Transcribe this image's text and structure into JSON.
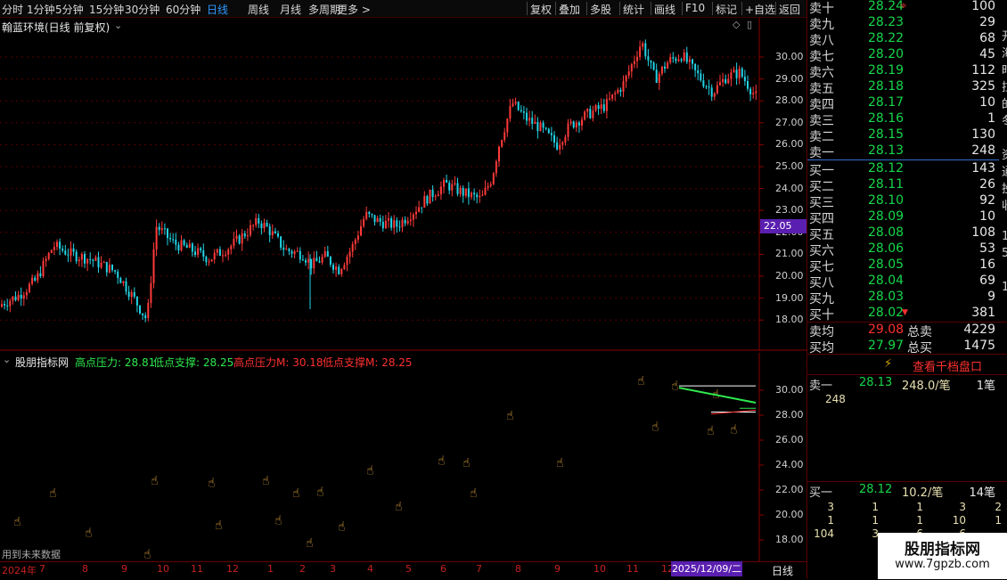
{
  "toolbar": {
    "periods": [
      "分时",
      "1分钟",
      "5分钟",
      "15分钟",
      "30分钟",
      "60分钟",
      "日线",
      "周线",
      "月线",
      "多周期",
      "更多 >"
    ],
    "active_period": "日线",
    "tools": [
      "复权",
      "叠加",
      "多股",
      "统计",
      "画线",
      "F10",
      "标记",
      "+自选",
      "返回"
    ]
  },
  "main_chart": {
    "title": "翰蓝环境(日线 前复权)",
    "current_price_badge": "22.05",
    "y_ticks": [
      "30.00",
      "29.00",
      "28.00",
      "27.00",
      "26.00",
      "25.00",
      "24.00",
      "23.00",
      "22.00",
      "21.00",
      "20.00",
      "19.00",
      "18.00"
    ]
  },
  "indicator": {
    "name": "股朋指标网",
    "items": [
      {
        "label": "高点压力: 28.81",
        "color": "#2ee84e"
      },
      {
        "label": "低点支撑: 28.25",
        "color": "#2ee84e"
      },
      {
        "label": "高点压力M: 30.18",
        "color": "#ff3030"
      },
      {
        "label": "低点支撑M: 28.25",
        "color": "#ff3030"
      }
    ],
    "y_ticks": [
      "30.00",
      "28.00",
      "26.00",
      "24.00",
      "22.00",
      "20.00",
      "18.00"
    ],
    "future_text": "用到未来数据"
  },
  "time_axis": {
    "labels": [
      "2024年",
      "7",
      "8",
      "9",
      "10",
      "11",
      "12",
      "1",
      "2",
      "3",
      "4",
      "5",
      "6",
      "7",
      "8",
      "9",
      "10",
      "11",
      "12"
    ],
    "date_badge": "2025/12/09/二",
    "period_label": "日线"
  },
  "order_book": {
    "asks": [
      {
        "label": "卖十",
        "price": "28.24",
        "vol": "100"
      },
      {
        "label": "卖九",
        "price": "28.23",
        "vol": "29"
      },
      {
        "label": "卖八",
        "price": "28.22",
        "vol": "68"
      },
      {
        "label": "卖七",
        "price": "28.20",
        "vol": "45"
      },
      {
        "label": "卖六",
        "price": "28.19",
        "vol": "112"
      },
      {
        "label": "卖五",
        "price": "28.18",
        "vol": "325"
      },
      {
        "label": "卖四",
        "price": "28.17",
        "vol": "10"
      },
      {
        "label": "卖三",
        "price": "28.16",
        "vol": "1"
      },
      {
        "label": "卖二",
        "price": "28.15",
        "vol": "130"
      },
      {
        "label": "卖一",
        "price": "28.13",
        "vol": "248"
      }
    ],
    "bids": [
      {
        "label": "买一",
        "price": "28.12",
        "vol": "143"
      },
      {
        "label": "买二",
        "price": "28.11",
        "vol": "26"
      },
      {
        "label": "买三",
        "price": "28.10",
        "vol": "92"
      },
      {
        "label": "买四",
        "price": "28.09",
        "vol": "10"
      },
      {
        "label": "买五",
        "price": "28.08",
        "vol": "108"
      },
      {
        "label": "买六",
        "price": "28.06",
        "vol": "53"
      },
      {
        "label": "买七",
        "price": "28.05",
        "vol": "16"
      },
      {
        "label": "买八",
        "price": "28.04",
        "vol": "69"
      },
      {
        "label": "买九",
        "price": "28.03",
        "vol": "9"
      },
      {
        "label": "买十",
        "price": "28.02",
        "vol": "381"
      }
    ],
    "sell_avg_label": "卖均",
    "sell_avg": "29.08",
    "total_sell_label": "总卖",
    "total_sell": "4229",
    "buy_avg_label": "买均",
    "buy_avg": "27.97",
    "total_buy_label": "总买",
    "total_buy": "1475",
    "qianfang_button": "查看千档盘口",
    "queue_sell": {
      "label": "卖一",
      "price": "28.13",
      "lots": "248.0/笔",
      "count": "1笔",
      "detail": "248"
    },
    "queue_buy": {
      "label": "买一",
      "price": "28.12",
      "lots": "10.2/笔",
      "count": "14笔"
    },
    "queue_rows": [
      [
        "3",
        "1",
        "1",
        "3",
        "2"
      ],
      [
        "1",
        "1",
        "1",
        "10",
        "1"
      ],
      [
        "104",
        "3",
        "6",
        "6",
        ""
      ]
    ],
    "right_margin_chars": [
      "开",
      "海",
      "时",
      "拉",
      "的",
      "冬",
      "",
      "资",
      "通",
      "投",
      "收",
      "",
      "1",
      "5",
      "",
      "1"
    ]
  },
  "watermark": {
    "title": "股朋指标网",
    "url": "www.7gpzb.com"
  },
  "colors": {
    "up": "#ff3030",
    "down": "#20d0e0",
    "grid": "#6a0000",
    "accent_purple": "#5a1fb0",
    "green": "#16d64a"
  }
}
